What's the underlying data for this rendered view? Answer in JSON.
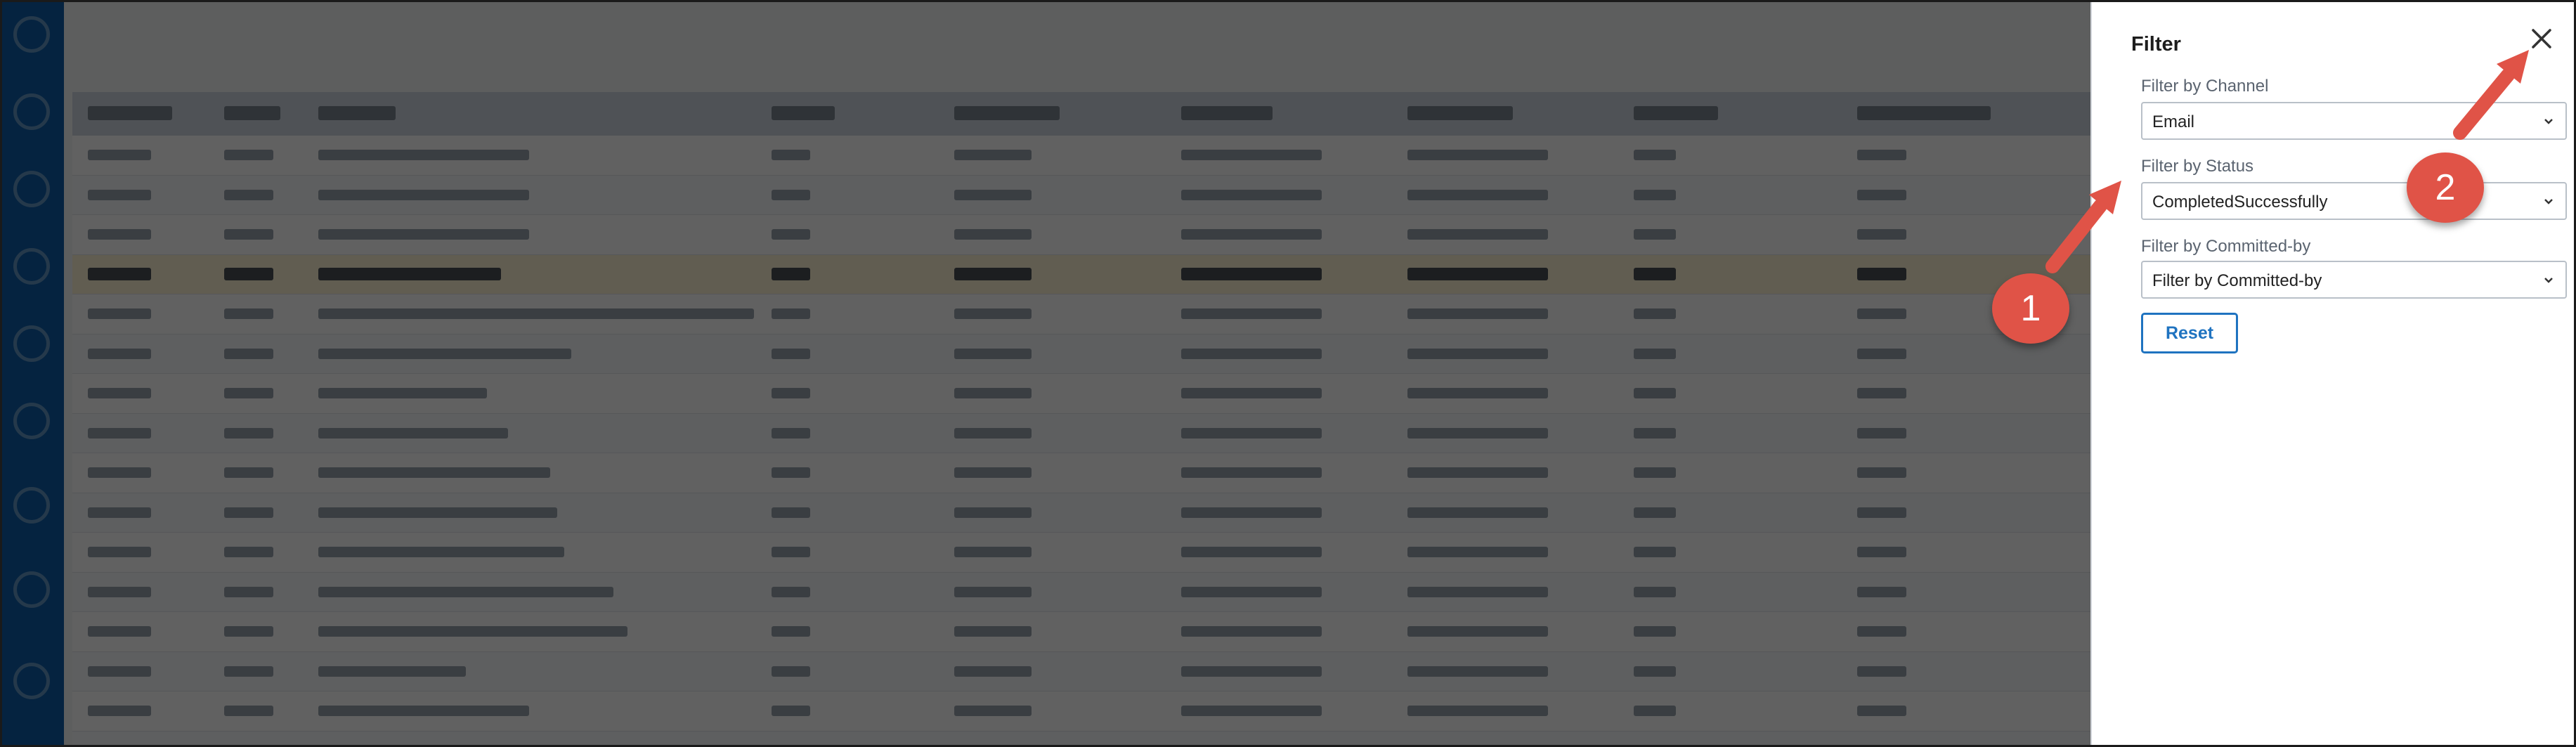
{
  "background_page": {
    "title": ""
  },
  "filter_panel": {
    "title": "Filter",
    "channel": {
      "label": "Filter by Channel",
      "value": "Email"
    },
    "status": {
      "label": "Filter by Status",
      "value": "CompletedSuccessfully"
    },
    "committed_by": {
      "label": "Filter by Committed-by",
      "value": "Filter by Committed-by"
    },
    "reset_label": "Reset"
  },
  "annotations": {
    "badge_1": "1",
    "badge_2": "2",
    "color": "#e05347"
  },
  "icons": [
    "close-icon",
    "chevron-down-icon"
  ],
  "colors": {
    "accent": "#1f73c0",
    "nav_rail": "#0f5ea8",
    "annotation": "#e05347"
  }
}
